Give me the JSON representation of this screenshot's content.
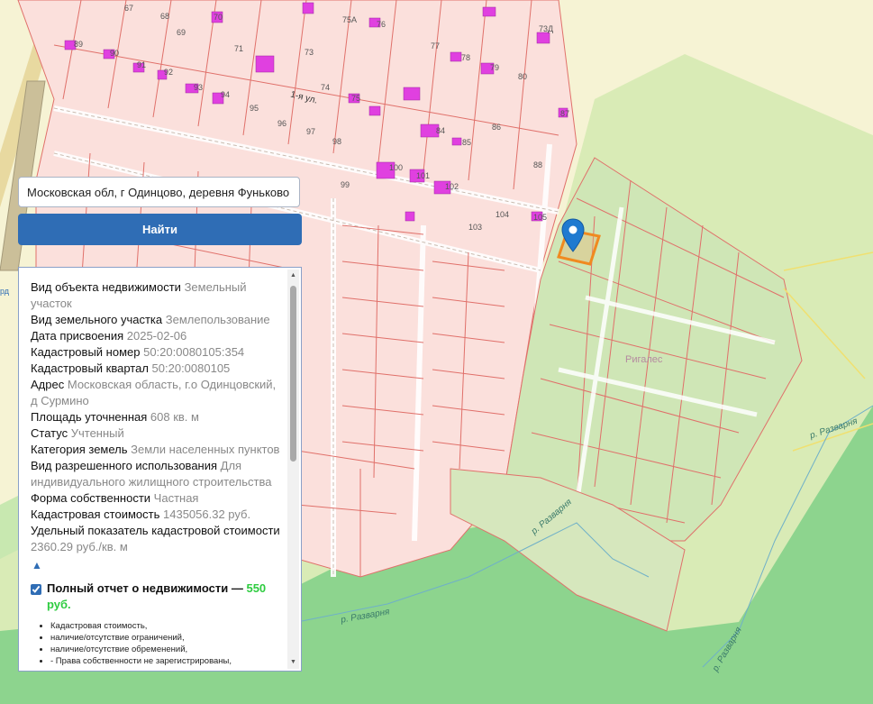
{
  "search": {
    "value": "Московская обл, г Одинцово, деревня Фуньково",
    "button_label": "Найти"
  },
  "info": {
    "rows": [
      {
        "key": "Вид объекта недвижимости",
        "value": "Земельный участок"
      },
      {
        "key": "Вид земельного участка",
        "value": "Землепользование"
      },
      {
        "key": "Дата присвоения",
        "value": "2025-02-06"
      },
      {
        "key": "Кадастровый номер",
        "value": "50:20:0080105:354"
      },
      {
        "key": "Кадастровый квартал",
        "value": "50:20:0080105"
      },
      {
        "key": "Адрес",
        "value": "Московская область, г.о Одинцовский, д Сурмино"
      },
      {
        "key": "Площадь уточненная",
        "value": "608 кв. м"
      },
      {
        "key": "Статус",
        "value": "Учтенный"
      },
      {
        "key": "Категория земель",
        "value": "Земли населенных пунктов"
      },
      {
        "key": "Вид разрешенного использования",
        "value": "Для индивидуального жилищного строительства"
      },
      {
        "key": "Форма собственности",
        "value": "Частная"
      },
      {
        "key": "Кадастровая стоимость",
        "value": "1435056.32 руб."
      },
      {
        "key": "Удельный показатель кадастровой стоимости",
        "value": "2360.29 руб./кв. м"
      }
    ],
    "collapse_icon": "▲",
    "report": {
      "checked": true,
      "title": "Полный отчет о недвижимости —",
      "price": "550 руб.",
      "items": [
        "Кадастровая стоимость,",
        "наличие/отсутствие ограничений,",
        "наличие/отсутствие обременений,",
        "- Права собственности не зарегистрированы,"
      ]
    }
  },
  "map": {
    "street_label": "1-я ул.",
    "area_label": "Ригалес",
    "river_labels": [
      "р. Разварня",
      "р. Разварня",
      "р. Разварня",
      "р. Разварня"
    ],
    "left_edge_fragment": "рд",
    "lot_numbers": [
      "67",
      "68",
      "69",
      "70",
      "71",
      "73",
      "75А",
      "76",
      "77",
      "78",
      "79",
      "80",
      "73Д",
      "89",
      "90",
      "91",
      "92",
      "93",
      "94",
      "95",
      "96",
      "97",
      "98",
      "99",
      "100",
      "101",
      "102",
      "103",
      "104",
      "105",
      "74",
      "75",
      "84",
      "85",
      "86",
      "87",
      "88"
    ],
    "marker_icon": "map-pin-icon",
    "colors": {
      "parcel_fill": "#fbe0dc",
      "parcel_stroke": "#e0706a",
      "building": "#e040e0",
      "forest": "#8fd48f",
      "light_green": "#d8eab8",
      "pale_yellow": "#f7f3c8",
      "selected_parcel": "#f08a20",
      "marker": "#1f7ad0"
    }
  }
}
